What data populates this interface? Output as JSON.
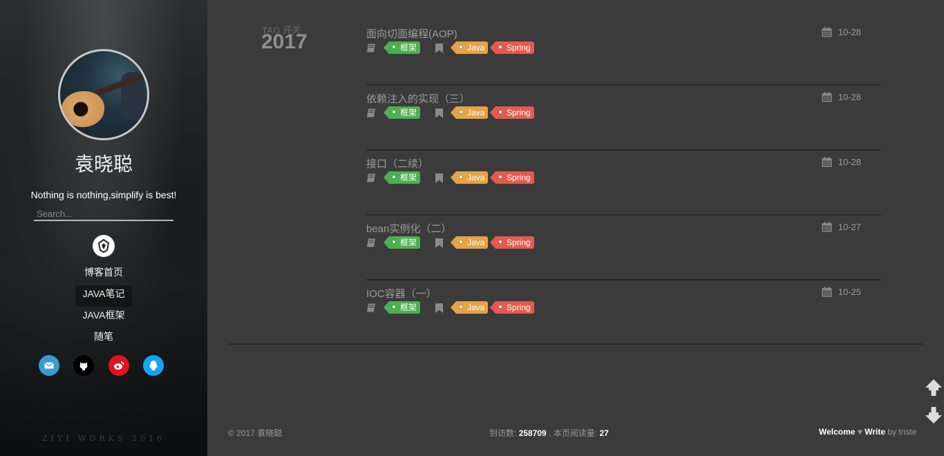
{
  "sidebar": {
    "name": "袁晓聪",
    "motto": "Nothing is nothing,simplify is best!",
    "search_placeholder": "Search...",
    "nav": [
      {
        "label": "博客首页"
      },
      {
        "label": "JAVA笔记"
      },
      {
        "label": "JAVA框架"
      },
      {
        "label": "随笔"
      }
    ],
    "social_icons": [
      "mail-icon",
      "github-icon",
      "weibo-icon",
      "qq-icon"
    ],
    "watermark": "ZIYI WORKS 2016"
  },
  "main": {
    "tag_toggle": "TAG 开关",
    "year": "2017",
    "posts": [
      {
        "title": "面向切面编程(AOP)",
        "date": "10-28",
        "category": "框架",
        "tags": [
          "Java",
          "Spring"
        ]
      },
      {
        "title": "依赖注入的实现（三）",
        "date": "10-28",
        "category": "框架",
        "tags": [
          "Java",
          "Spring"
        ]
      },
      {
        "title": "接口（二续）",
        "date": "10-28",
        "category": "框架",
        "tags": [
          "Java",
          "Spring"
        ]
      },
      {
        "title": "bean实例化（二）",
        "date": "10-27",
        "category": "框架",
        "tags": [
          "Java",
          "Spring"
        ]
      },
      {
        "title": "IOC容器（一）",
        "date": "10-25",
        "category": "框架",
        "tags": [
          "Java",
          "Spring"
        ]
      }
    ]
  },
  "footer": {
    "copyright": "© 2017 袁晓聪",
    "visits_label": "到访数:",
    "visits": "258709",
    "reads_label": ", 本页阅读量:",
    "reads": "27",
    "welcome": "Welcome",
    "write": "Write",
    "by": "by triste"
  },
  "colors": {
    "background": "#3b3b3b",
    "category_tag": "#4caf50",
    "java_tag": "#e4a347",
    "spring_tag": "#e35b4f",
    "mail": "#3b9bd0",
    "github": "#000000",
    "weibo": "#e0141d",
    "qq": "#12a6f2"
  }
}
